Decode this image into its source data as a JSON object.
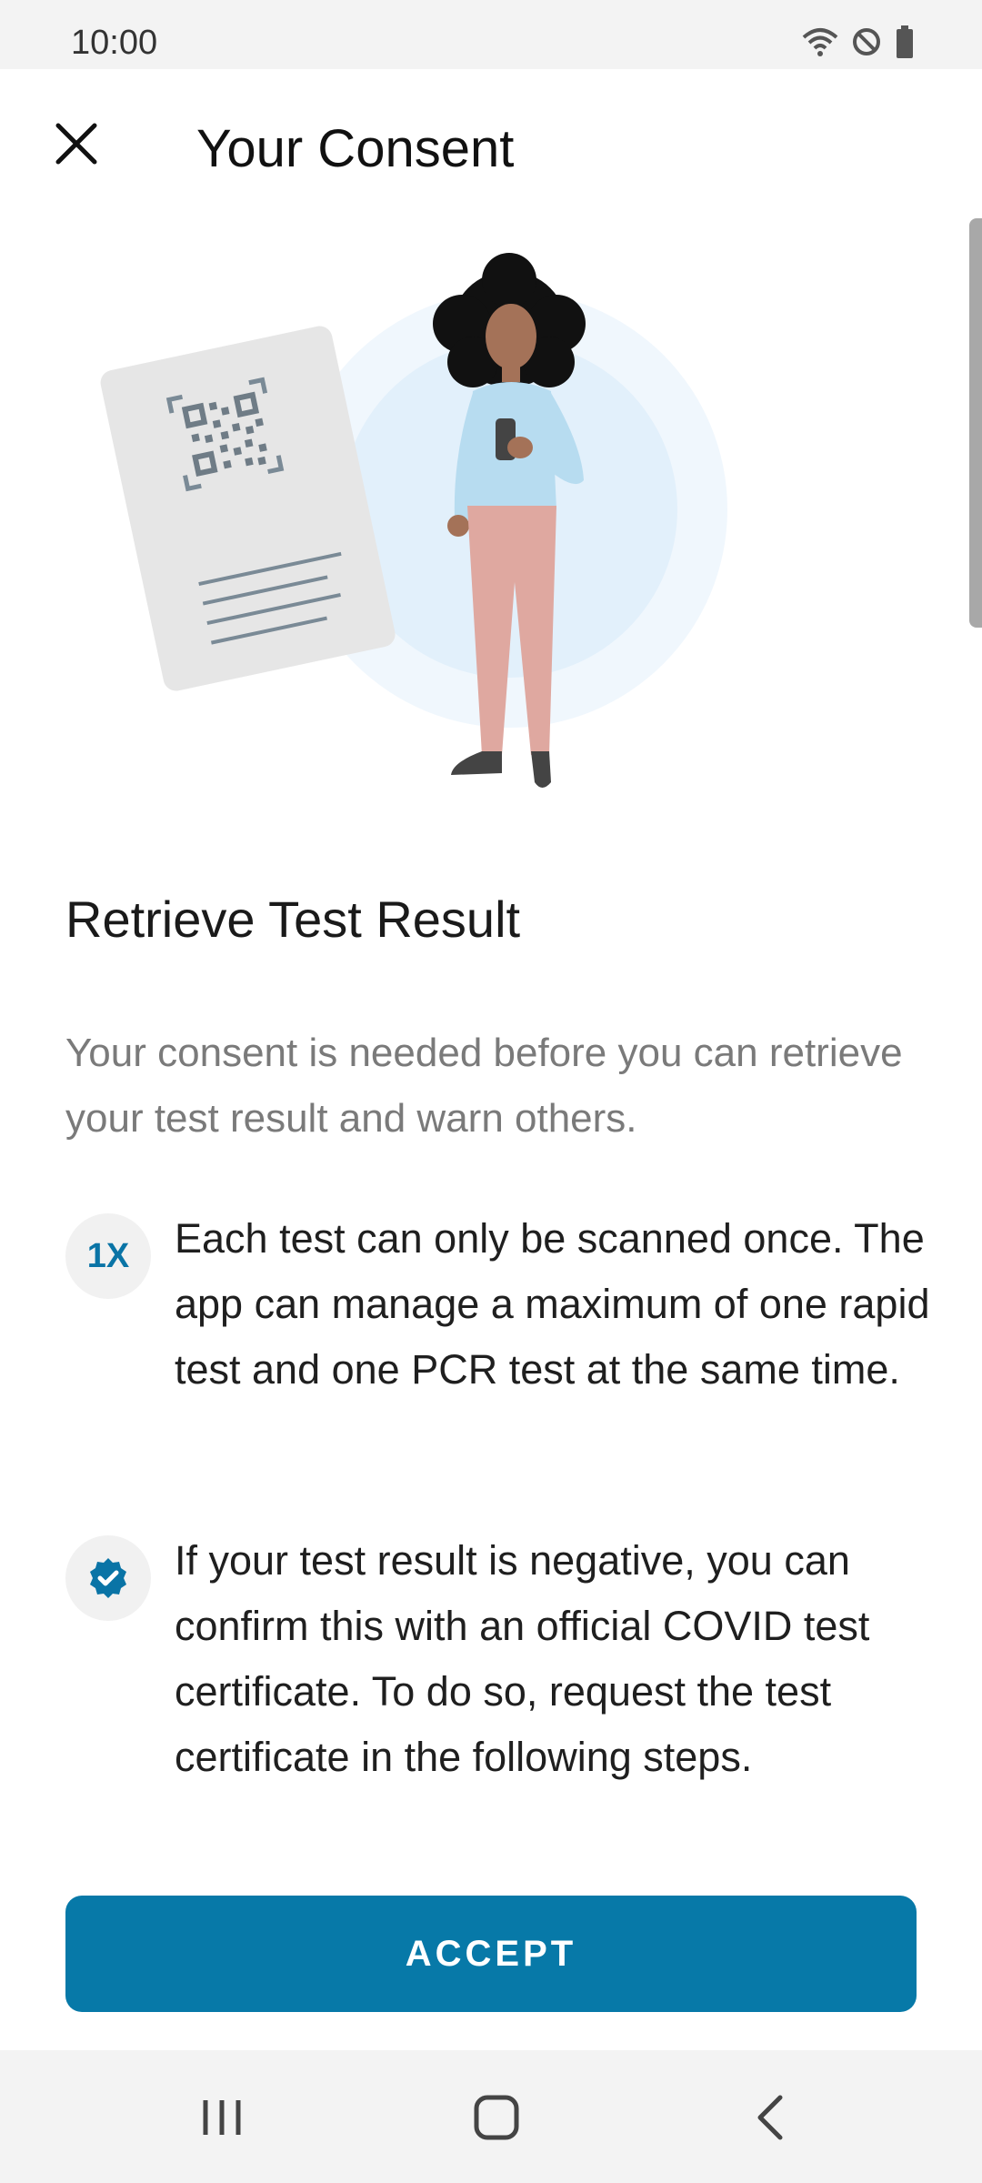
{
  "status_bar": {
    "time": "10:00",
    "icons": [
      "wifi-icon",
      "do-not-disturb-icon",
      "battery-icon"
    ]
  },
  "toolbar": {
    "title": "Your Consent",
    "close_icon": "close-icon"
  },
  "content": {
    "section_title": "Retrieve Test Result",
    "intro": "Your consent is needed before you can retrieve your test result and warn others.",
    "items": [
      {
        "icon_text": "1X",
        "text": "Each test can only be scanned once. The app can manage a maximum of one rapid test and one PCR test at the same time."
      },
      {
        "icon": "verified-badge-icon",
        "text": "If your test result is negative, you can confirm this with an official COVID test certificate. To do so, request the test certificate in the following steps."
      }
    ],
    "accept_label": "ACCEPT"
  },
  "colors": {
    "accent": "#0779a8",
    "secondary_text": "#7a7a7a",
    "status_bar_bg": "#f3f3f3"
  },
  "nav_bar": {
    "icons": [
      "recent-apps-icon",
      "home-icon",
      "back-icon"
    ]
  }
}
